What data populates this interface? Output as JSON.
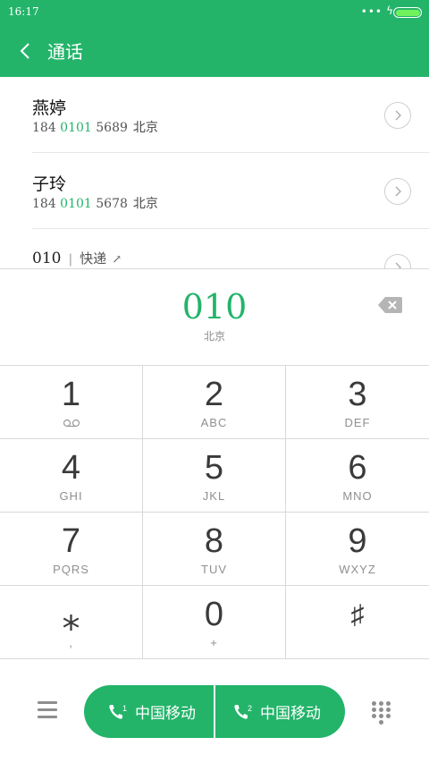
{
  "status_bar": {
    "time": "16:17",
    "dots": "•••",
    "charging": "ϟ"
  },
  "header": {
    "title": "通话"
  },
  "contacts": [
    {
      "name": "燕婷",
      "number_prefix": "184 ",
      "number_match": "0101",
      "number_suffix": " 5689",
      "location": "北京"
    },
    {
      "name": "子玲",
      "number_prefix": "184 ",
      "number_match": "0101",
      "number_suffix": " 5678",
      "location": "北京"
    },
    {
      "number": "010",
      "separator": "|",
      "tag": "快递",
      "tag_arrow": "↗"
    }
  ],
  "dial": {
    "number": "010",
    "location": "北京"
  },
  "keypad": [
    {
      "digit": "1",
      "letters": ""
    },
    {
      "digit": "2",
      "letters": "ABC"
    },
    {
      "digit": "3",
      "letters": "DEF"
    },
    {
      "digit": "4",
      "letters": "GHI"
    },
    {
      "digit": "5",
      "letters": "JKL"
    },
    {
      "digit": "6",
      "letters": "MNO"
    },
    {
      "digit": "7",
      "letters": "PQRS"
    },
    {
      "digit": "8",
      "letters": "TUV"
    },
    {
      "digit": "9",
      "letters": "WXYZ"
    },
    {
      "digit": "⁎",
      "letters": ","
    },
    {
      "digit": "0",
      "letters": "+"
    },
    {
      "digit": "♯",
      "letters": ""
    }
  ],
  "call_buttons": [
    {
      "sim": "1",
      "carrier": "中国移动"
    },
    {
      "sim": "2",
      "carrier": "中国移动"
    }
  ],
  "colors": {
    "accent": "#23b46a",
    "battery": "#6ff25b"
  },
  "icons": {
    "back": "back-arrow-icon",
    "arrow": "chevron-right-icon",
    "backspace": "backspace-icon",
    "voicemail": "voicemail-icon",
    "menu": "menu-icon",
    "phone": "phone-icon",
    "keypad": "dialpad-icon"
  }
}
